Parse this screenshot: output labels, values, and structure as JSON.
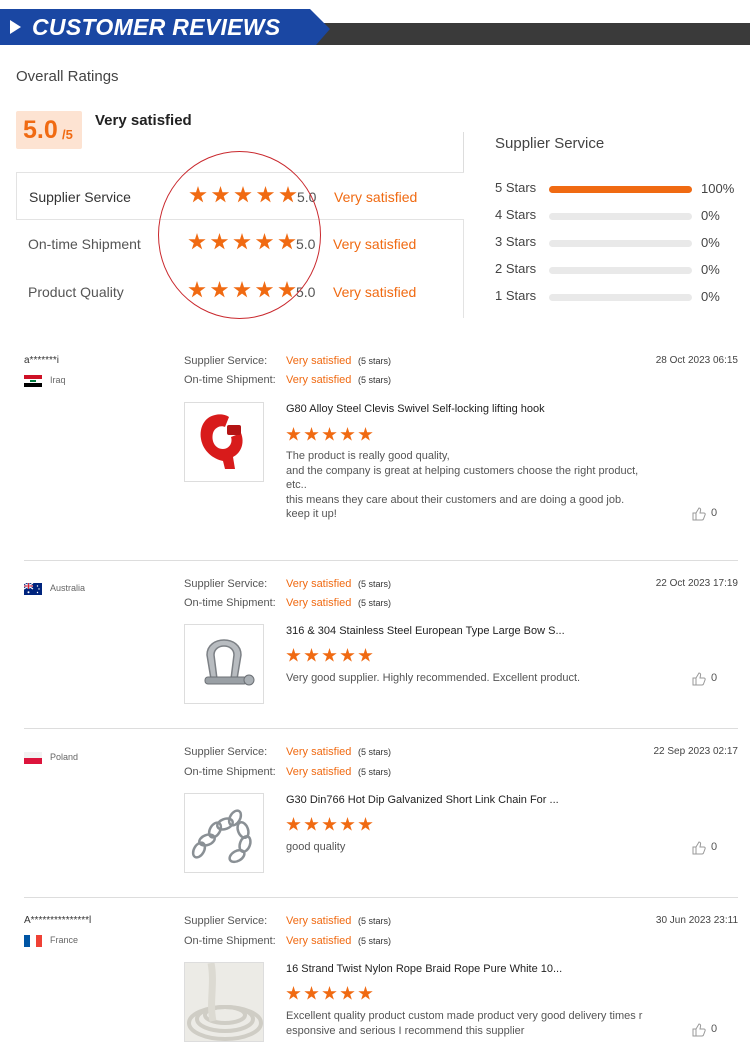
{
  "banner": {
    "title": "CUSTOMER REVIEWS"
  },
  "overall": {
    "title": "Overall Ratings",
    "score": "5.0",
    "score_max": "/5",
    "label": "Very satisfied",
    "rows": [
      {
        "label": "Supplier Service",
        "score": "5.0",
        "text": "Very satisfied"
      },
      {
        "label": "On-time Shipment",
        "score": "5.0",
        "text": "Very satisfied"
      },
      {
        "label": "Product Quality",
        "score": "5.0",
        "text": "Very satisfied"
      }
    ]
  },
  "distribution": {
    "title": "Supplier Service",
    "rows": [
      {
        "label": "5 Stars",
        "pct": "100%",
        "fraction": 1.0
      },
      {
        "label": "4 Stars",
        "pct": "0%",
        "fraction": 0
      },
      {
        "label": "3 Stars",
        "pct": "0%",
        "fraction": 0
      },
      {
        "label": "2 Stars",
        "pct": "0%",
        "fraction": 0
      },
      {
        "label": "1 Stars",
        "pct": "0%",
        "fraction": 0
      }
    ]
  },
  "review_labels": {
    "supplier_service": "Supplier Service:",
    "on_time_shipment": "On-time Shipment:",
    "value": "Very satisfied",
    "count": "(5 stars)"
  },
  "reviews": [
    {
      "user": "a*******i",
      "country": "Iraq",
      "date": "28 Oct 2023 06:15",
      "product": "G80 Alloy Steel Clevis Swivel Self-locking lifting hook",
      "comment_lines": [
        "The product is really good quality,",
        "and the company is great at helping customers choose the right product,",
        "etc..",
        "this means they care about their customers and are doing a good job.",
        "keep it up!"
      ],
      "likes": "0"
    },
    {
      "user": "",
      "country": "Australia",
      "date": "22 Oct 2023 17:19",
      "product": "316 & 304 Stainless Steel European Type Large Bow S...",
      "comment_lines": [
        "Very good supplier. Highly recommended. Excellent product."
      ],
      "likes": "0"
    },
    {
      "user": "",
      "country": "Poland",
      "date": "22 Sep 2023 02:17",
      "product": "G30 Din766 Hot Dip Galvanized Short Link Chain For ...",
      "comment_lines": [
        "good quality"
      ],
      "likes": "0"
    },
    {
      "user": "A***************l",
      "country": "France",
      "date": "30 Jun 2023 23:11",
      "product": "16 Strand Twist Nylon Rope Braid Rope Pure White 10...",
      "comment_lines": [
        "Excellent quality product custom made product very good delivery times r",
        "esponsive and serious I recommend this supplier"
      ],
      "likes": "0"
    }
  ],
  "colors": {
    "accent": "#f06a12",
    "banner_blue": "#1a47a3",
    "banner_dark": "#3a3a3a",
    "circle": "#c9282d"
  }
}
